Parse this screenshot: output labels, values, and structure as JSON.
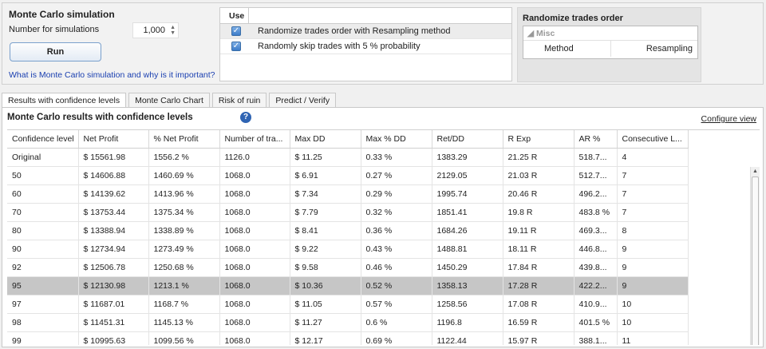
{
  "settings": {
    "title": "Monte Carlo simulation",
    "num_label": "Number for simulations",
    "num_value": "1,000",
    "run_label": "Run",
    "help_link": "What is Monte Carlo simulation and why is it important?"
  },
  "use_panel": {
    "header": "Use",
    "options": [
      {
        "label": "Randomize trades order with Resampling method",
        "checked": true
      },
      {
        "label": "Randomly skip trades with 5 % probability",
        "checked": true
      }
    ]
  },
  "randomize_panel": {
    "title": "Randomize trades order",
    "group": "Misc",
    "key": "Method",
    "value": "Resampling"
  },
  "tabs": [
    "Results with confidence levels",
    "Monte Carlo Chart",
    "Risk of ruin",
    "Predict / Verify"
  ],
  "results": {
    "title": "Monte Carlo results with confidence levels",
    "configure": "Configure view",
    "columns": [
      "Confidence level",
      "Net Profit",
      "% Net Profit",
      "Number of tra...",
      "Max DD",
      "Max % DD",
      "Ret/DD",
      "R Exp",
      "AR %",
      "Consecutive L..."
    ],
    "rows": [
      [
        "Original",
        "$ 15561.98",
        "1556.2 %",
        "1126.0",
        "$ 11.25",
        "0.33 %",
        "1383.29",
        "21.25 R",
        "518.7...",
        "4"
      ],
      [
        "50",
        "$ 14606.88",
        "1460.69 %",
        "1068.0",
        "$ 6.91",
        "0.27 %",
        "2129.05",
        "21.03 R",
        "512.7...",
        "7"
      ],
      [
        "60",
        "$ 14139.62",
        "1413.96 %",
        "1068.0",
        "$ 7.34",
        "0.29 %",
        "1995.74",
        "20.46 R",
        "496.2...",
        "7"
      ],
      [
        "70",
        "$ 13753.44",
        "1375.34 %",
        "1068.0",
        "$ 7.79",
        "0.32 %",
        "1851.41",
        "19.8 R",
        "483.8 %",
        "7"
      ],
      [
        "80",
        "$ 13388.94",
        "1338.89 %",
        "1068.0",
        "$ 8.41",
        "0.36 %",
        "1684.26",
        "19.11 R",
        "469.3...",
        "8"
      ],
      [
        "90",
        "$ 12734.94",
        "1273.49 %",
        "1068.0",
        "$ 9.22",
        "0.43 %",
        "1488.81",
        "18.11 R",
        "446.8...",
        "9"
      ],
      [
        "92",
        "$ 12506.78",
        "1250.68 %",
        "1068.0",
        "$ 9.58",
        "0.46 %",
        "1450.29",
        "17.84 R",
        "439.8...",
        "9"
      ],
      [
        "95",
        "$ 12130.98",
        "1213.1 %",
        "1068.0",
        "$ 10.36",
        "0.52 %",
        "1358.13",
        "17.28 R",
        "422.2...",
        "9"
      ],
      [
        "97",
        "$ 11687.01",
        "1168.7 %",
        "1068.0",
        "$ 11.05",
        "0.57 %",
        "1258.56",
        "17.08 R",
        "410.9...",
        "10"
      ],
      [
        "98",
        "$ 11451.31",
        "1145.13 %",
        "1068.0",
        "$ 11.27",
        "0.6 %",
        "1196.8",
        "16.59 R",
        "401.5 %",
        "10"
      ],
      [
        "99",
        "$ 10995.63",
        "1099.56 %",
        "1068.0",
        "$ 12.17",
        "0.69 %",
        "1122.44",
        "15.97 R",
        "388.1...",
        "11"
      ]
    ],
    "highlighted_row": 7
  }
}
